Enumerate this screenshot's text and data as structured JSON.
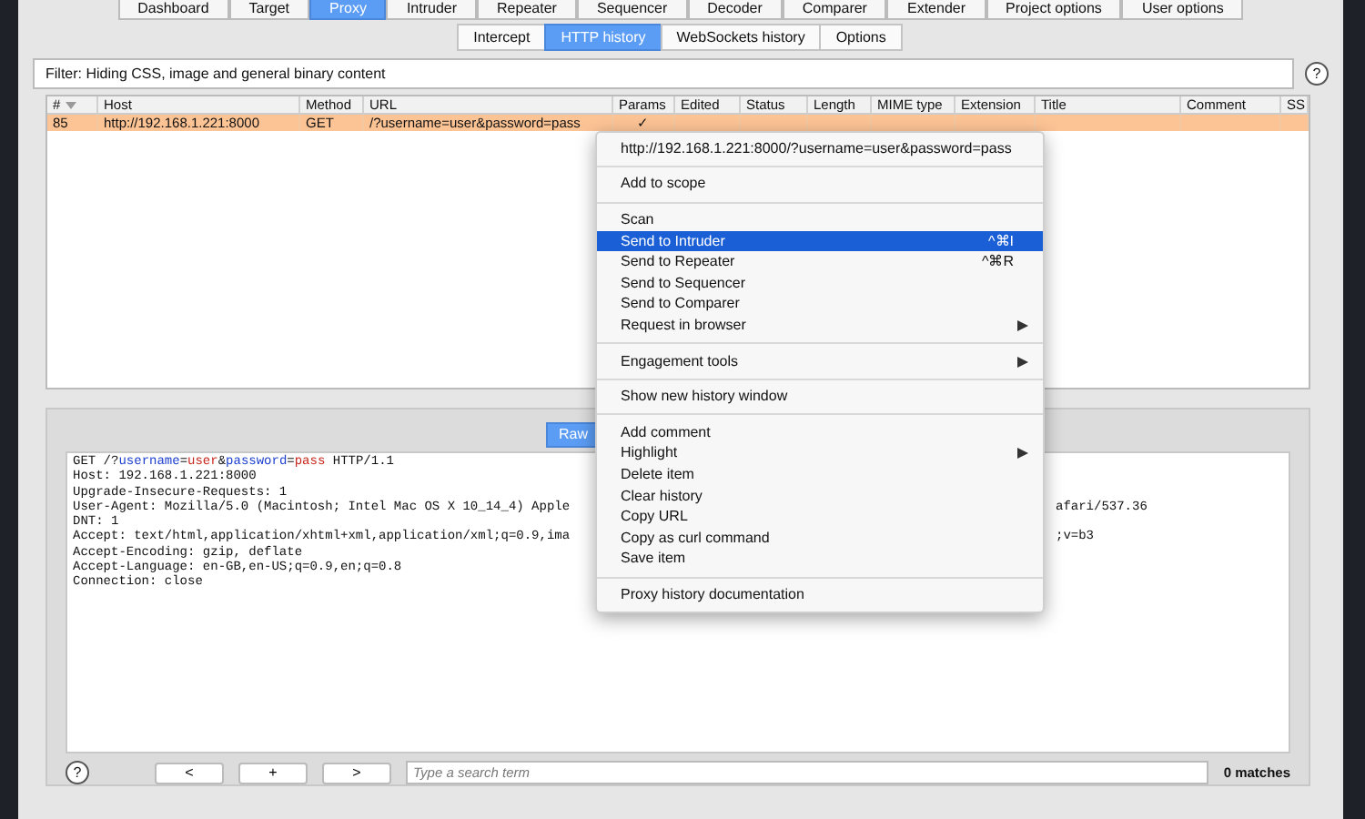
{
  "top_tabs": [
    {
      "label": "Dashboard",
      "selected": false
    },
    {
      "label": "Target",
      "selected": false
    },
    {
      "label": "Proxy",
      "selected": true
    },
    {
      "label": "Intruder",
      "selected": false
    },
    {
      "label": "Repeater",
      "selected": false
    },
    {
      "label": "Sequencer",
      "selected": false
    },
    {
      "label": "Decoder",
      "selected": false
    },
    {
      "label": "Comparer",
      "selected": false
    },
    {
      "label": "Extender",
      "selected": false
    },
    {
      "label": "Project options",
      "selected": false
    },
    {
      "label": "User options",
      "selected": false
    }
  ],
  "sub_tabs": [
    {
      "label": "Intercept",
      "selected": false
    },
    {
      "label": "HTTP history",
      "selected": true
    },
    {
      "label": "WebSockets history",
      "selected": false
    },
    {
      "label": "Options",
      "selected": false
    }
  ],
  "filter": {
    "text": "Filter: Hiding CSS, image and general binary content",
    "help": "?"
  },
  "table": {
    "columns": [
      "#",
      "Host",
      "Method",
      "URL",
      "Params",
      "Edited",
      "Status",
      "Length",
      "MIME type",
      "Extension",
      "Title",
      "Comment",
      "SS"
    ],
    "rows": [
      {
        "cells": [
          "85",
          "http://192.168.1.221:8000",
          "GET",
          "/?username=user&password=pass",
          "✓"
        ],
        "selected": true
      }
    ]
  },
  "editor_tabs": [
    {
      "label": "Raw",
      "selected": true
    }
  ],
  "request_lines": [
    {
      "segments": [
        {
          "text": "GET /?",
          "kind": "plain"
        },
        {
          "text": "username",
          "kind": "param"
        },
        {
          "text": "=",
          "kind": "plain"
        },
        {
          "text": "user",
          "kind": "value"
        },
        {
          "text": "&",
          "kind": "plain"
        },
        {
          "text": "password",
          "kind": "param"
        },
        {
          "text": "=",
          "kind": "plain"
        },
        {
          "text": "pass",
          "kind": "value"
        },
        {
          "text": " HTTP/1.1",
          "kind": "plain"
        }
      ]
    },
    {
      "segments": [
        {
          "text": "Host: 192.168.1.221:8000",
          "kind": "plain"
        }
      ]
    },
    {
      "segments": [
        {
          "text": "Upgrade-Insecure-Requests: 1",
          "kind": "plain"
        }
      ]
    },
    {
      "segments": [
        {
          "text": "User-Agent: Mozilla/5.0 (Macintosh; Intel Mac OS X 10_14_4) Apple",
          "kind": "plain"
        }
      ],
      "tail": "afari/537.36"
    },
    {
      "segments": [
        {
          "text": "DNT: 1",
          "kind": "plain"
        }
      ]
    },
    {
      "segments": [
        {
          "text": "Accept: text/html,application/xhtml+xml,application/xml;q=0.9,ima",
          "kind": "plain"
        }
      ],
      "tail": ";v=b3"
    },
    {
      "segments": [
        {
          "text": "Accept-Encoding: gzip, deflate",
          "kind": "plain"
        }
      ]
    },
    {
      "segments": [
        {
          "text": "Accept-Language: en-GB,en-US;q=0.9,en;q=0.8",
          "kind": "plain"
        }
      ]
    },
    {
      "segments": [
        {
          "text": "Connection: close",
          "kind": "plain"
        }
      ]
    }
  ],
  "search": {
    "help": "?",
    "buttons": [
      "<",
      "+",
      ">"
    ],
    "placeholder": "Type a search term",
    "matches": "0 matches"
  },
  "context_menu": {
    "items": [
      {
        "kind": "header",
        "label": "http://192.168.1.221:8000/?username=user&password=pass"
      },
      {
        "kind": "separator"
      },
      {
        "kind": "item",
        "label": "Add to scope",
        "selected": false
      },
      {
        "kind": "separator"
      },
      {
        "kind": "item",
        "label": "Scan",
        "selected": false
      },
      {
        "kind": "item",
        "label": "Send to Intruder",
        "selected": true,
        "shortcut": "^⌘I"
      },
      {
        "kind": "item",
        "label": "Send to Repeater",
        "selected": false,
        "shortcut": "^⌘R"
      },
      {
        "kind": "item",
        "label": "Send to Sequencer",
        "selected": false
      },
      {
        "kind": "item",
        "label": "Send to Comparer",
        "selected": false
      },
      {
        "kind": "item",
        "label": "Request in browser",
        "selected": false,
        "submenu": true
      },
      {
        "kind": "separator"
      },
      {
        "kind": "item",
        "label": "Engagement tools",
        "selected": false,
        "submenu": true
      },
      {
        "kind": "separator"
      },
      {
        "kind": "item",
        "label": "Show new history window",
        "selected": false
      },
      {
        "kind": "separator"
      },
      {
        "kind": "item",
        "label": "Add comment",
        "selected": false
      },
      {
        "kind": "item",
        "label": "Highlight",
        "selected": false,
        "submenu": true
      },
      {
        "kind": "item",
        "label": "Delete item",
        "selected": false
      },
      {
        "kind": "item",
        "label": "Clear history",
        "selected": false
      },
      {
        "kind": "item",
        "label": "Copy URL",
        "selected": false
      },
      {
        "kind": "item",
        "label": "Copy as curl command",
        "selected": false
      },
      {
        "kind": "item",
        "label": "Save item",
        "selected": false
      },
      {
        "kind": "separator"
      },
      {
        "kind": "item",
        "label": "Proxy history documentation",
        "selected": false
      }
    ]
  }
}
